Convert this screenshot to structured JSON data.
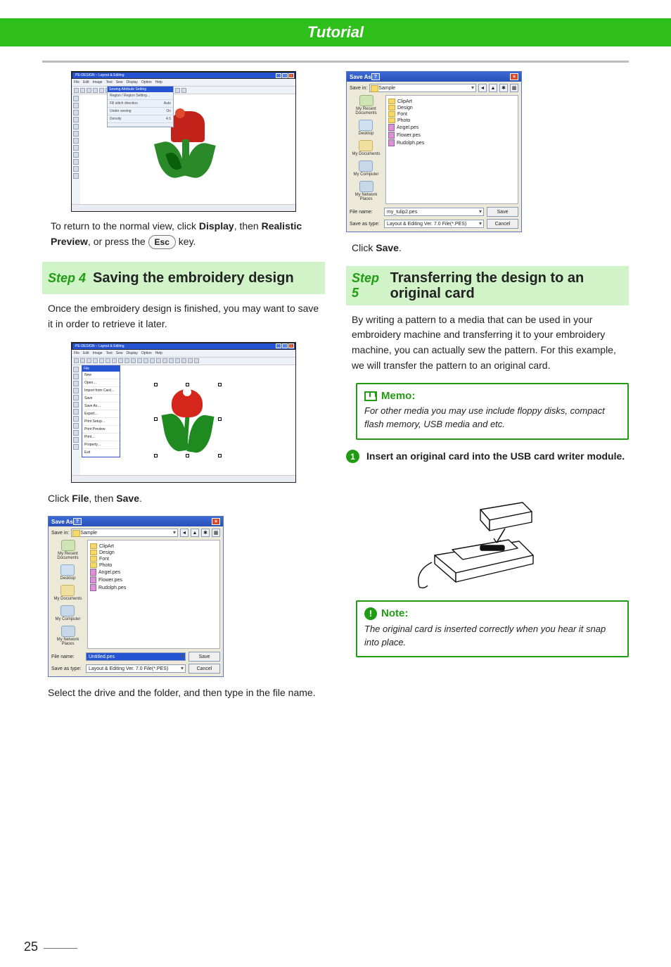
{
  "header": {
    "title": "Tutorial"
  },
  "left": {
    "preview_caption_1": "To return to the normal view, click ",
    "preview_display": "Display",
    "preview_caption_2": ", then ",
    "preview_realistic": "Realistic Preview",
    "preview_caption_3": ", or press the ",
    "esc_key": "Esc",
    "preview_caption_4": " key.",
    "step4_label": "Step 4",
    "step4_title": "Saving the embroidery design",
    "step4_intro": "Once the embroidery design is finished, you may want to save it in order to retrieve it later.",
    "file_save_1": "Click ",
    "file_save_file": "File",
    "file_save_2": ", then ",
    "file_save_save": "Save",
    "file_save_3": ".",
    "select_drive": "Select the drive and the folder, and then type in the file name."
  },
  "right": {
    "click_save_1": "Click ",
    "click_save_save": "Save",
    "click_save_2": ".",
    "step5_label": "Step 5",
    "step5_title": "Transferring the design to an original card",
    "step5_intro": "By writing a pattern to a media that can be used in your embroidery machine and transferring it to your embroidery machine, you can actually sew the pattern. For this example, we will transfer the pattern to an original card.",
    "memo_title": "Memo:",
    "memo_body": "For other media you may use include floppy disks, compact flash memory, USB media and etc.",
    "numstep_1": "Insert an original card into the USB card writer module.",
    "note_title": "Note:",
    "note_body": "The original card is inserted correctly when you hear it snap into place."
  },
  "app_window": {
    "title": "PE-DESIGN – Layout & Editing",
    "menus": [
      "File",
      "Edit",
      "Image",
      "Text",
      "Sew",
      "Display",
      "Option",
      "Help"
    ],
    "panel_title": "Sewing Attribute Setting",
    "panel_rows": [
      {
        "k": "Region / Region Setting…",
        "v": ""
      },
      {
        "k": "Fill stitch direction",
        "v": "Auto"
      },
      {
        "k": "",
        "v": ""
      },
      {
        "k": "Under sewing",
        "v": "On"
      },
      {
        "k": "",
        "v": ""
      },
      {
        "k": "Density",
        "v": "4.5"
      },
      {
        "k": "",
        "v": ""
      }
    ],
    "file_menu": {
      "heading": "File",
      "items": [
        "New",
        "Open…",
        "Import from Card…",
        "",
        "Save",
        "Save As…",
        "",
        "Export…",
        "",
        "Print Setup…",
        "Print Preview",
        "Print…",
        "",
        "Property…",
        "",
        "Exit"
      ]
    }
  },
  "save_dialog": {
    "title": "Save As",
    "savein_label": "Save in:",
    "savein_value": "Sample",
    "places": [
      "My Recent Documents",
      "Desktop",
      "My Documents",
      "My Computer",
      "My Network Places"
    ],
    "folders": [
      "ClipArt",
      "Design",
      "Font",
      "Photo"
    ],
    "files": [
      "Angel.pes",
      "Flower.pes",
      "Rudolph.pes"
    ],
    "filename_label": "File name:",
    "filetype_label": "Save as type:",
    "filename1": "Untitled.pes",
    "filename2": "my_tulip2.pes",
    "filetype": "Layout & Editing Ver. 7.0 File(*.PES)",
    "save_btn": "Save",
    "cancel_btn": "Cancel"
  },
  "page_number": "25"
}
